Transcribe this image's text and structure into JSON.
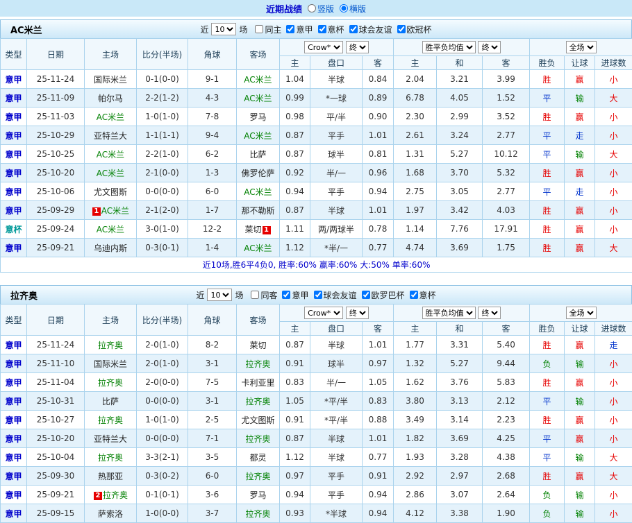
{
  "page": {
    "title": "近期战绩",
    "layout_options": [
      {
        "label": "竖版",
        "selected": false
      },
      {
        "label": "横版",
        "selected": true
      }
    ]
  },
  "type_colors": {
    "意甲": "#0000cc",
    "意杯": "#009999"
  },
  "result_colors": {
    "胜": "#e60000",
    "平": "#0033cc",
    "负": "#008000",
    "赢": "#e60000",
    "输": "#008000",
    "走": "#0033cc",
    "大": "#e60000",
    "小": "#e60000"
  },
  "sections": [
    {
      "team": "AC米兰",
      "filters": {
        "prefix": "近",
        "count": "10",
        "suffix": "场",
        "checkboxes": [
          {
            "label": "同主",
            "checked": false
          },
          {
            "label": "意甲",
            "checked": true
          },
          {
            "label": "意杯",
            "checked": true
          },
          {
            "label": "球会友谊",
            "checked": true
          },
          {
            "label": "欧冠杯",
            "checked": true
          }
        ]
      },
      "header": {
        "type": "类型",
        "date": "日期",
        "home": "主场",
        "score": "比分(半场)",
        "corner": "角球",
        "away": "客场",
        "odds_company": "Crow*",
        "odds_stage": "终",
        "europe_avg": "胜平负均值",
        "europe_stage": "终",
        "fulltime": "全场",
        "sub": [
          "主",
          "盘口",
          "客",
          "主",
          "和",
          "客",
          "胜负",
          "让球",
          "进球数"
        ]
      },
      "rows": [
        {
          "type": "意甲",
          "date": "25-11-24",
          "home": "国际米兰",
          "home_team": false,
          "home_badge": "",
          "score": "0-1(0-0)",
          "corner": "9-1",
          "away": "AC米兰",
          "away_team": true,
          "away_badge": "",
          "o1": "1.04",
          "handicap": "半球",
          "o2": "0.84",
          "e1": "2.04",
          "e2": "3.21",
          "e3": "3.99",
          "r1": "胜",
          "r2": "赢",
          "r3": "小"
        },
        {
          "type": "意甲",
          "date": "25-11-09",
          "home": "帕尔马",
          "home_team": false,
          "home_badge": "",
          "score": "2-2(1-2)",
          "corner": "4-3",
          "away": "AC米兰",
          "away_team": true,
          "away_badge": "",
          "o1": "0.99",
          "handicap": "*一球",
          "o2": "0.89",
          "e1": "6.78",
          "e2": "4.05",
          "e3": "1.52",
          "r1": "平",
          "r2": "输",
          "r3": "大"
        },
        {
          "type": "意甲",
          "date": "25-11-03",
          "home": "AC米兰",
          "home_team": true,
          "home_badge": "",
          "score": "1-0(1-0)",
          "corner": "7-8",
          "away": "罗马",
          "away_team": false,
          "away_badge": "",
          "o1": "0.98",
          "handicap": "平/半",
          "o2": "0.90",
          "e1": "2.30",
          "e2": "2.99",
          "e3": "3.52",
          "r1": "胜",
          "r2": "赢",
          "r3": "小"
        },
        {
          "type": "意甲",
          "date": "25-10-29",
          "home": "亚特兰大",
          "home_team": false,
          "home_badge": "",
          "score": "1-1(1-1)",
          "corner": "9-4",
          "away": "AC米兰",
          "away_team": true,
          "away_badge": "",
          "o1": "0.87",
          "handicap": "平手",
          "o2": "1.01",
          "e1": "2.61",
          "e2": "3.24",
          "e3": "2.77",
          "r1": "平",
          "r2": "走",
          "r3": "小"
        },
        {
          "type": "意甲",
          "date": "25-10-25",
          "home": "AC米兰",
          "home_team": true,
          "home_badge": "",
          "score": "2-2(1-0)",
          "corner": "6-2",
          "away": "比萨",
          "away_team": false,
          "away_badge": "",
          "o1": "0.87",
          "handicap": "球半",
          "o2": "0.81",
          "e1": "1.31",
          "e2": "5.27",
          "e3": "10.12",
          "r1": "平",
          "r2": "输",
          "r3": "大"
        },
        {
          "type": "意甲",
          "date": "25-10-20",
          "home": "AC米兰",
          "home_team": true,
          "home_badge": "",
          "score": "2-1(0-0)",
          "corner": "1-3",
          "away": "佛罗伦萨",
          "away_team": false,
          "away_badge": "",
          "o1": "0.92",
          "handicap": "半/一",
          "o2": "0.96",
          "e1": "1.68",
          "e2": "3.70",
          "e3": "5.32",
          "r1": "胜",
          "r2": "赢",
          "r3": "小"
        },
        {
          "type": "意甲",
          "date": "25-10-06",
          "home": "尤文图斯",
          "home_team": false,
          "home_badge": "",
          "score": "0-0(0-0)",
          "corner": "6-0",
          "away": "AC米兰",
          "away_team": true,
          "away_badge": "",
          "o1": "0.94",
          "handicap": "平手",
          "o2": "0.94",
          "e1": "2.75",
          "e2": "3.05",
          "e3": "2.77",
          "r1": "平",
          "r2": "走",
          "r3": "小"
        },
        {
          "type": "意甲",
          "date": "25-09-29",
          "home": "AC米兰",
          "home_team": true,
          "home_badge": "1",
          "score": "2-1(2-0)",
          "corner": "1-7",
          "away": "那不勒斯",
          "away_team": false,
          "away_badge": "",
          "o1": "0.87",
          "handicap": "半球",
          "o2": "1.01",
          "e1": "1.97",
          "e2": "3.42",
          "e3": "4.03",
          "r1": "胜",
          "r2": "赢",
          "r3": "小"
        },
        {
          "type": "意杯",
          "date": "25-09-24",
          "home": "AC米兰",
          "home_team": true,
          "home_badge": "",
          "score": "3-0(1-0)",
          "corner": "12-2",
          "away": "莱切",
          "away_team": false,
          "away_badge": "1",
          "o1": "1.11",
          "handicap": "两/两球半",
          "o2": "0.78",
          "e1": "1.14",
          "e2": "7.76",
          "e3": "17.91",
          "r1": "胜",
          "r2": "赢",
          "r3": "小"
        },
        {
          "type": "意甲",
          "date": "25-09-21",
          "home": "乌迪内斯",
          "home_team": false,
          "home_badge": "",
          "score": "0-3(0-1)",
          "corner": "1-4",
          "away": "AC米兰",
          "away_team": true,
          "away_badge": "",
          "o1": "1.12",
          "handicap": "*半/一",
          "o2": "0.77",
          "e1": "4.74",
          "e2": "3.69",
          "e3": "1.75",
          "r1": "胜",
          "r2": "赢",
          "r3": "大"
        }
      ],
      "footer": "近10场,胜6平4负0, 胜率:60% 赢率:60% 大:50% 单率:60%"
    },
    {
      "team": "拉齐奥",
      "filters": {
        "prefix": "近",
        "count": "10",
        "suffix": "场",
        "checkboxes": [
          {
            "label": "同客",
            "checked": false
          },
          {
            "label": "意甲",
            "checked": true
          },
          {
            "label": "球会友谊",
            "checked": true
          },
          {
            "label": "欧罗巴杯",
            "checked": true
          },
          {
            "label": "意杯",
            "checked": true
          }
        ]
      },
      "header": {
        "type": "类型",
        "date": "日期",
        "home": "主场",
        "score": "比分(半场)",
        "corner": "角球",
        "away": "客场",
        "odds_company": "Crow*",
        "odds_stage": "终",
        "europe_avg": "胜平负均值",
        "europe_stage": "终",
        "fulltime": "全场",
        "sub": [
          "主",
          "盘口",
          "客",
          "主",
          "和",
          "客",
          "胜负",
          "让球",
          "进球数"
        ]
      },
      "rows": [
        {
          "type": "意甲",
          "date": "25-11-24",
          "home": "拉齐奥",
          "home_team": true,
          "home_badge": "",
          "score": "2-0(1-0)",
          "corner": "8-2",
          "away": "莱切",
          "away_team": false,
          "away_badge": "",
          "o1": "0.87",
          "handicap": "半球",
          "o2": "1.01",
          "e1": "1.77",
          "e2": "3.31",
          "e3": "5.40",
          "r1": "胜",
          "r2": "赢",
          "r3": "走"
        },
        {
          "type": "意甲",
          "date": "25-11-10",
          "home": "国际米兰",
          "home_team": false,
          "home_badge": "",
          "score": "2-0(1-0)",
          "corner": "3-1",
          "away": "拉齐奥",
          "away_team": true,
          "away_badge": "",
          "o1": "0.91",
          "handicap": "球半",
          "o2": "0.97",
          "e1": "1.32",
          "e2": "5.27",
          "e3": "9.44",
          "r1": "负",
          "r2": "输",
          "r3": "小"
        },
        {
          "type": "意甲",
          "date": "25-11-04",
          "home": "拉齐奥",
          "home_team": true,
          "home_badge": "",
          "score": "2-0(0-0)",
          "corner": "7-5",
          "away": "卡利亚里",
          "away_team": false,
          "away_badge": "",
          "o1": "0.83",
          "handicap": "半/一",
          "o2": "1.05",
          "e1": "1.62",
          "e2": "3.76",
          "e3": "5.83",
          "r1": "胜",
          "r2": "赢",
          "r3": "小"
        },
        {
          "type": "意甲",
          "date": "25-10-31",
          "home": "比萨",
          "home_team": false,
          "home_badge": "",
          "score": "0-0(0-0)",
          "corner": "3-1",
          "away": "拉齐奥",
          "away_team": true,
          "away_badge": "",
          "o1": "1.05",
          "handicap": "*平/半",
          "o2": "0.83",
          "e1": "3.80",
          "e2": "3.13",
          "e3": "2.12",
          "r1": "平",
          "r2": "输",
          "r3": "小"
        },
        {
          "type": "意甲",
          "date": "25-10-27",
          "home": "拉齐奥",
          "home_team": true,
          "home_badge": "",
          "score": "1-0(1-0)",
          "corner": "2-5",
          "away": "尤文图斯",
          "away_team": false,
          "away_badge": "",
          "o1": "0.91",
          "handicap": "*平/半",
          "o2": "0.88",
          "e1": "3.49",
          "e2": "3.14",
          "e3": "2.23",
          "r1": "胜",
          "r2": "赢",
          "r3": "小"
        },
        {
          "type": "意甲",
          "date": "25-10-20",
          "home": "亚特兰大",
          "home_team": false,
          "home_badge": "",
          "score": "0-0(0-0)",
          "corner": "7-1",
          "away": "拉齐奥",
          "away_team": true,
          "away_badge": "",
          "o1": "0.87",
          "handicap": "半球",
          "o2": "1.01",
          "e1": "1.82",
          "e2": "3.69",
          "e3": "4.25",
          "r1": "平",
          "r2": "赢",
          "r3": "小"
        },
        {
          "type": "意甲",
          "date": "25-10-04",
          "home": "拉齐奥",
          "home_team": true,
          "home_badge": "",
          "score": "3-3(2-1)",
          "corner": "3-5",
          "away": "都灵",
          "away_team": false,
          "away_badge": "",
          "o1": "1.12",
          "handicap": "半球",
          "o2": "0.77",
          "e1": "1.93",
          "e2": "3.28",
          "e3": "4.38",
          "r1": "平",
          "r2": "输",
          "r3": "大"
        },
        {
          "type": "意甲",
          "date": "25-09-30",
          "home": "热那亚",
          "home_team": false,
          "home_badge": "",
          "score": "0-3(0-2)",
          "corner": "6-0",
          "away": "拉齐奥",
          "away_team": true,
          "away_badge": "",
          "o1": "0.97",
          "handicap": "平手",
          "o2": "0.91",
          "e1": "2.92",
          "e2": "2.97",
          "e3": "2.68",
          "r1": "胜",
          "r2": "赢",
          "r3": "大"
        },
        {
          "type": "意甲",
          "date": "25-09-21",
          "home": "拉齐奥",
          "home_team": true,
          "home_badge": "2",
          "score": "0-1(0-1)",
          "corner": "3-6",
          "away": "罗马",
          "away_team": false,
          "away_badge": "",
          "o1": "0.94",
          "handicap": "平手",
          "o2": "0.94",
          "e1": "2.86",
          "e2": "3.07",
          "e3": "2.64",
          "r1": "负",
          "r2": "输",
          "r3": "小"
        },
        {
          "type": "意甲",
          "date": "25-09-15",
          "home": "萨索洛",
          "home_team": false,
          "home_badge": "",
          "score": "1-0(0-0)",
          "corner": "3-7",
          "away": "拉齐奥",
          "away_team": true,
          "away_badge": "",
          "o1": "0.93",
          "handicap": "*半球",
          "o2": "0.94",
          "e1": "4.12",
          "e2": "3.38",
          "e3": "1.90",
          "r1": "负",
          "r2": "输",
          "r3": "小"
        }
      ]
    }
  ]
}
